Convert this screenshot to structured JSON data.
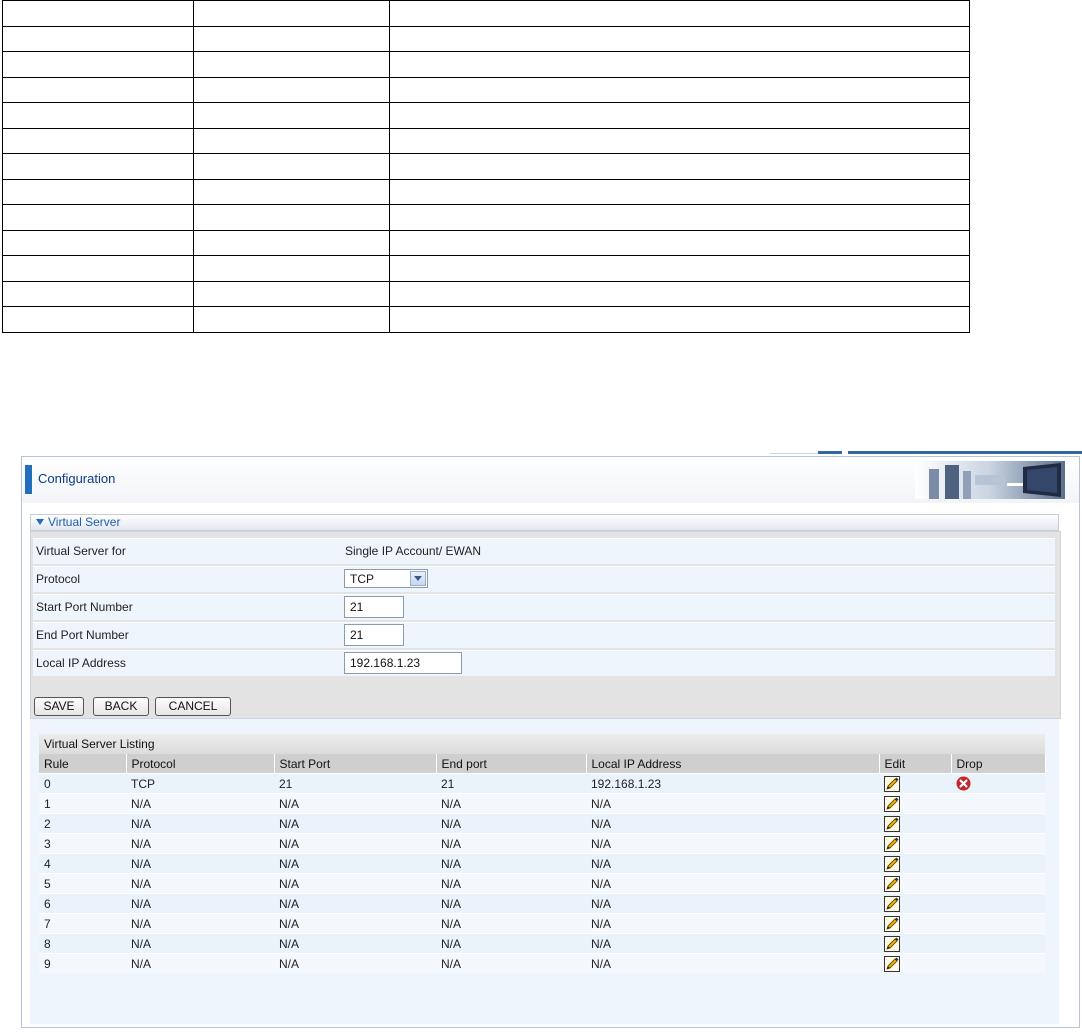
{
  "header": {
    "title": "Configuration"
  },
  "section": {
    "title": "Virtual Server"
  },
  "form": {
    "rows": [
      {
        "label": "Virtual Server for",
        "value": "Single IP Account/ EWAN"
      },
      {
        "label": "Protocol",
        "value": "TCP"
      },
      {
        "label": "Start Port Number",
        "value": "21"
      },
      {
        "label": "End Port Number",
        "value": "21"
      },
      {
        "label": "Local IP Address",
        "value": "192.168.1.23"
      }
    ]
  },
  "buttons": {
    "save": "SAVE",
    "back": "BACK",
    "cancel": "CANCEL"
  },
  "listing": {
    "title": "Virtual Server Listing",
    "columns": [
      "Rule",
      "Protocol",
      "Start Port",
      "End port",
      "Local IP Address",
      "Edit",
      "Drop"
    ],
    "rows": [
      [
        "0",
        "TCP",
        "21",
        "21",
        "192.168.1.23"
      ],
      [
        "1",
        "N/A",
        "N/A",
        "N/A",
        "N/A"
      ],
      [
        "2",
        "N/A",
        "N/A",
        "N/A",
        "N/A"
      ],
      [
        "3",
        "N/A",
        "N/A",
        "N/A",
        "N/A"
      ],
      [
        "4",
        "N/A",
        "N/A",
        "N/A",
        "N/A"
      ],
      [
        "5",
        "N/A",
        "N/A",
        "N/A",
        "N/A"
      ],
      [
        "6",
        "N/A",
        "N/A",
        "N/A",
        "N/A"
      ],
      [
        "7",
        "N/A",
        "N/A",
        "N/A",
        "N/A"
      ],
      [
        "8",
        "N/A",
        "N/A",
        "N/A",
        "N/A"
      ],
      [
        "9",
        "N/A",
        "N/A",
        "N/A",
        "N/A"
      ]
    ],
    "drop_visible_rows": [
      "0"
    ]
  },
  "colors": {
    "accent": "#1f6fbd",
    "title": "#0b3a88",
    "drop": "#c0282c"
  }
}
